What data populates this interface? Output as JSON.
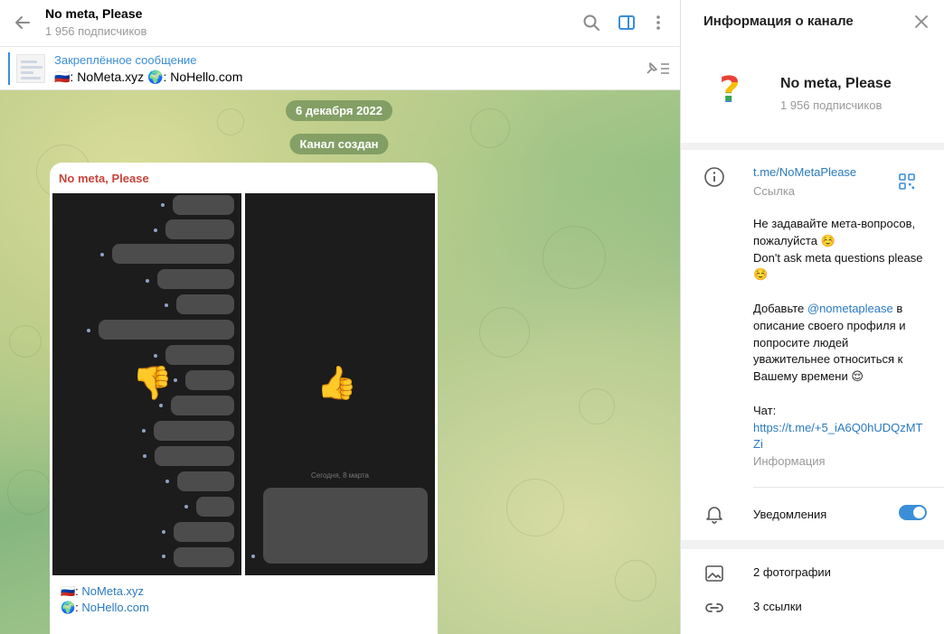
{
  "chat_header": {
    "title": "No meta, Please",
    "subscribers": "1 956 подписчиков"
  },
  "pinned": {
    "title": "Закреплённое сообщение",
    "text": "🇷🇺: NoMeta.xyz 🌍: NoHello.com"
  },
  "dates": {
    "date": "6 декабря 2022",
    "service": "Канал создан"
  },
  "message": {
    "author": "No meta, Please",
    "screenshot_left_emoji": "👎",
    "screenshot_right_emoji": "👍",
    "screenshot_right_caption": "Сегодня, 8 марта",
    "line1_flag": "🇷🇺: ",
    "line1_link": "NoMeta.xyz",
    "line2_flag": "🌍: ",
    "line2_link": "NoHello.com"
  },
  "info_panel": {
    "title": "Информация о канале",
    "avatar_glyph": "?",
    "channel_name": "No meta, Please",
    "subscribers": "1 956 подписчиков",
    "link": "t.me/NoMetaPlease",
    "link_label": "Ссылка",
    "description_ru": "Не задавайте мета-вопросов, пожалуйста ☺️",
    "description_en": "Don't ask meta questions please ☺️",
    "desc_add_prefix": "Добавьте ",
    "desc_mention": "@nometaplease",
    "desc_add_suffix": " в описание своего профиля и попросите людей уважительнее относиться к Вашему времени 😌",
    "chat_label": "Чат:",
    "chat_link": "https://t.me/+5_iA6Q0hUDQzMTZi",
    "info_label": "Информация",
    "notifications_label": "Уведомления",
    "notifications_on": true,
    "photos_label": "2 фотографии",
    "links_label": "3 ссылки"
  },
  "colors": {
    "accent": "#3a8fd8",
    "author": "#c8443b",
    "link": "#2a7ac0"
  }
}
